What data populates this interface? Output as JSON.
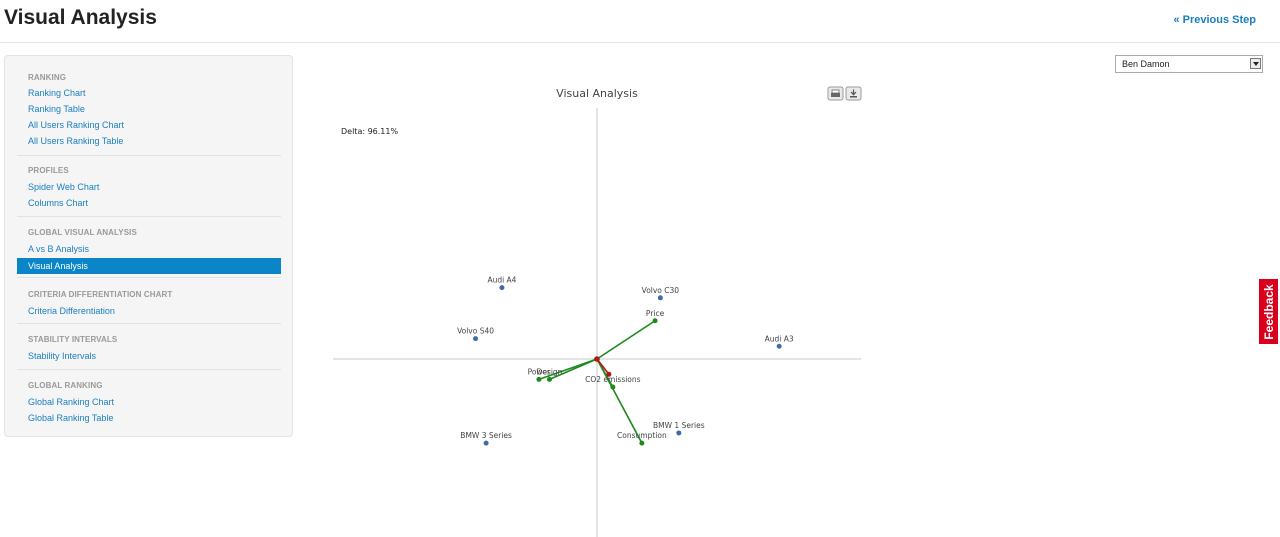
{
  "header": {
    "title": "Visual Analysis",
    "prev_step": "« Previous Step"
  },
  "sidebar": {
    "sections": [
      {
        "heading": "RANKING",
        "items": [
          "Ranking Chart",
          "Ranking Table",
          "All Users Ranking Chart",
          "All Users Ranking Table"
        ]
      },
      {
        "heading": "PROFILES",
        "items": [
          "Spider Web Chart",
          "Columns Chart"
        ]
      },
      {
        "heading": "GLOBAL VISUAL ANALYSIS",
        "items": [
          "A vs B Analysis",
          "Visual Analysis"
        ]
      },
      {
        "heading": "CRITERIA DIFFERENTIATION CHART",
        "items": [
          "Criteria Differentiation"
        ]
      },
      {
        "heading": "STABILITY INTERVALS",
        "items": [
          "Stability Intervals"
        ]
      },
      {
        "heading": "GLOBAL RANKING",
        "items": [
          "Global Ranking Chart",
          "Global Ranking Table"
        ]
      }
    ],
    "active_item": "Visual Analysis"
  },
  "user_select": {
    "value": "Ben Damon"
  },
  "feedback": {
    "label": "Feedback"
  },
  "chart_data": {
    "type": "scatter",
    "title": "Visual Analysis",
    "delta_label": "Delta: 96.11%",
    "xlim": [
      -1,
      1
    ],
    "ylim": [
      -1,
      1
    ],
    "grid": false,
    "alternatives": [
      {
        "name": "Audi A4",
        "x": -0.36,
        "y": 0.28
      },
      {
        "name": "Volvo C30",
        "x": 0.24,
        "y": 0.24
      },
      {
        "name": "Volvo S40",
        "x": -0.46,
        "y": 0.08
      },
      {
        "name": "Audi A3",
        "x": 0.69,
        "y": 0.05
      },
      {
        "name": "BMW 3 Series",
        "x": -0.42,
        "y": -0.33
      },
      {
        "name": "BMW 1 Series",
        "x": 0.31,
        "y": -0.29
      }
    ],
    "criteria": [
      {
        "name": "Price",
        "x": 0.22,
        "y": 0.15
      },
      {
        "name": "Power",
        "x": -0.22,
        "y": -0.08
      },
      {
        "name": "Design",
        "x": -0.18,
        "y": -0.08
      },
      {
        "name": "CO2 emissions",
        "x": 0.06,
        "y": -0.11
      },
      {
        "name": "Consumption",
        "x": 0.17,
        "y": -0.33
      }
    ],
    "decision_axis": {
      "x": 0.045,
      "y": -0.06
    },
    "colors": {
      "alternative": "#3f6ca8",
      "criterion": "#1e8a1e",
      "decision": "#b01818",
      "axis": "#c8c8c8"
    }
  }
}
